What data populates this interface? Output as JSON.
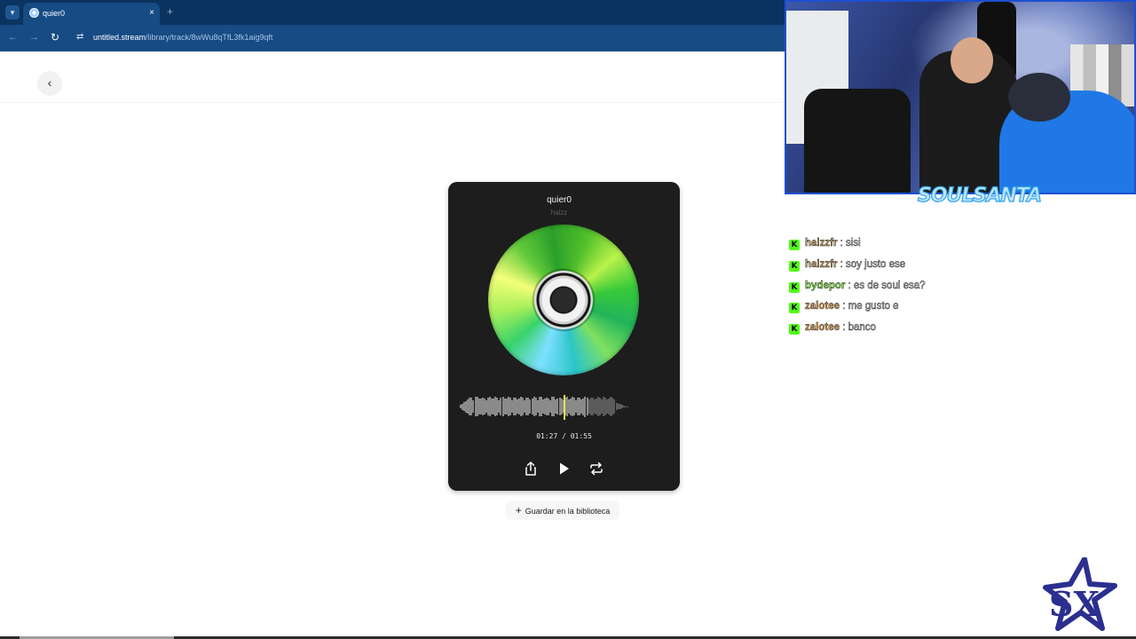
{
  "browser": {
    "tab_search_icon": "chevron-down-icon",
    "tab": {
      "title": "quier0",
      "close": "×",
      "favicon": "disc-favicon-icon"
    },
    "new_tab": "+",
    "nav": {
      "back": "←",
      "forward": "→",
      "reload": "↻",
      "site_info": "⇄"
    },
    "url": {
      "host": "untitled.stream",
      "path": "/library/track/8wWu8qTfL3fk1aig9qft"
    }
  },
  "page": {
    "back_button": "‹",
    "player": {
      "title": "quier0",
      "artist": "halzz",
      "progress": 0.75,
      "time": "01:27 / 01:55",
      "controls": [
        "share-icon",
        "play-icon",
        "repeat-icon"
      ],
      "playhead_color": "#f2e34a"
    },
    "save_button": {
      "icon": "+",
      "label": "Guardar en la biblioteca"
    }
  },
  "overlay": {
    "webcam_logo": "SOULSANTA",
    "chat": [
      {
        "user": "halzzfr",
        "user_color": "#c8a56e",
        "sep": ":",
        "text": "sisi"
      },
      {
        "user": "halzzfr",
        "user_color": "#c8a56e",
        "sep": ":",
        "text": "soy justo ese"
      },
      {
        "user": "bydepor",
        "user_color": "#86e04a",
        "sep": ":",
        "text": "es de soul esa?"
      },
      {
        "user": "zalotee",
        "user_color": "#e0a052",
        "sep": ":",
        "text": "me gusto e"
      },
      {
        "user": "zalotee",
        "user_color": "#e0a052",
        "sep": ":",
        "text": "banco"
      }
    ],
    "chat_badge": "K",
    "brand_mark": "SX"
  }
}
